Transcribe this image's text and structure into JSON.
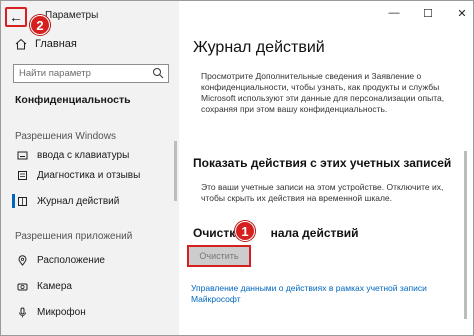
{
  "window": {
    "title": "Параметры",
    "controls": {
      "minimize": "—",
      "maximize": "☐",
      "close": "✕"
    }
  },
  "back": {
    "glyph": "←"
  },
  "steps": {
    "first": "1",
    "second": "2"
  },
  "sidebar": {
    "home": "Главная",
    "search_placeholder": "Найти параметр",
    "section": "Конфиденциальность",
    "group1": "Разрешения Windows",
    "items1": [
      {
        "label": "ввода с клавиатуры",
        "icon": "keyboard-icon"
      },
      {
        "label": "Диагностика и отзывы",
        "icon": "diagnostics-icon"
      },
      {
        "label": "Журнал действий",
        "icon": "activity-history-icon",
        "active": true
      }
    ],
    "group2": "Разрешения приложений",
    "items2": [
      {
        "label": "Расположение",
        "icon": "location-icon"
      },
      {
        "label": "Камера",
        "icon": "camera-icon"
      },
      {
        "label": "Микрофон",
        "icon": "microphone-icon"
      }
    ]
  },
  "main": {
    "title": "Журнал действий",
    "description": "Просмотрите Дополнительные сведения и Заявление о конфиденциальности, чтобы узнать, как продукты и службы Microsoft используют эти данные для персонализации опыта, сохраняя при этом вашу конфиденциальность.",
    "show_heading": "Показать действия с этих учетных записей",
    "show_description": "Это ваши учетные записи на этом устройстве. Отключите их, чтобы скрыть их действия на временной шкале.",
    "clear_heading_start": "Очистка",
    "clear_heading_end": "нала действий",
    "clear_button": "Очистить",
    "link_text": "Управление данными о действиях в рамках учетной записи Майкрософт"
  },
  "colors": {
    "accent": "#0067c0",
    "highlight": "#d62020"
  }
}
